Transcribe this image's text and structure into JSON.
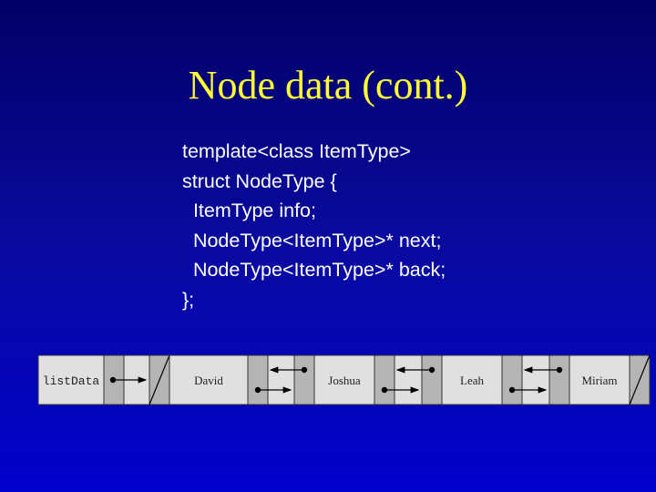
{
  "slide": {
    "title": "Node data (cont.)",
    "code_lines": [
      "template<class ItemType>",
      "struct NodeType {",
      "  ItemType info;",
      "  NodeType<ItemType>* next;",
      "  NodeType<ItemType>* back;",
      "};"
    ]
  },
  "diagram": {
    "head_label": "listData",
    "nodes": [
      "David",
      "Joshua",
      "Leah",
      "Miriam"
    ],
    "colors": {
      "light": "#e0e0e0",
      "dark": "#b4b4b4",
      "title": "#ffff33",
      "text": "#ffffff"
    }
  }
}
